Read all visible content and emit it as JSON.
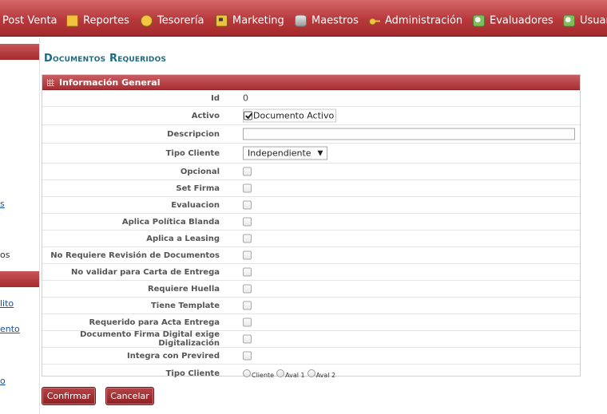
{
  "menu": {
    "items": [
      {
        "label": "Post Venta",
        "icon": ""
      },
      {
        "label": "Reportes",
        "icon": "book-icon"
      },
      {
        "label": "Tesorería",
        "icon": "coin-icon"
      },
      {
        "label": "Marketing",
        "icon": "monitor-icon"
      },
      {
        "label": "Maestros",
        "icon": "database-icon"
      },
      {
        "label": "Administración",
        "icon": "key-icon"
      },
      {
        "label": "Evaluadores",
        "icon": "evaluator-icon"
      },
      {
        "label": "Usuar",
        "icon": "evaluator-icon"
      }
    ]
  },
  "sidebar": {
    "fragments": [
      "s",
      "os",
      "lito",
      "ento",
      "o"
    ]
  },
  "page": {
    "title": "Documentos Requeridos"
  },
  "panel": {
    "title": "Información General",
    "fields": {
      "id": {
        "label": "Id",
        "value": "0"
      },
      "activo": {
        "label": "Activo",
        "checkbox_label": "Documento Activo",
        "checked": true
      },
      "descripcion": {
        "label": "Descripcion",
        "value": ""
      },
      "tipo_cliente_select": {
        "label": "Tipo Cliente",
        "value": "Independiente"
      },
      "checkboxes": [
        {
          "label": "Opcional",
          "checked": false
        },
        {
          "label": "Set Firma",
          "checked": false
        },
        {
          "label": "Evaluacion",
          "checked": false
        },
        {
          "label": "Aplica Política Blanda",
          "checked": false
        },
        {
          "label": "Aplica a Leasing",
          "checked": false
        },
        {
          "label": "No Requiere Revisión de Documentos",
          "checked": false
        },
        {
          "label": "No validar para Carta de Entrega",
          "checked": false
        },
        {
          "label": "Requiere Huella",
          "checked": false
        },
        {
          "label": "Tiene Template",
          "checked": false
        },
        {
          "label": "Requerido para Acta Entrega",
          "checked": false
        },
        {
          "label": "Documento Firma Digital exige Digitalización",
          "checked": false
        },
        {
          "label": "Integra con Previred",
          "checked": false
        }
      ],
      "tipo_cliente_radio": {
        "label": "Tipo Cliente",
        "options": [
          "Cliente",
          "Aval 1",
          "Aval 2"
        ]
      }
    }
  },
  "actions": {
    "confirm_label": "Confirmar",
    "cancel_label": "Cancelar"
  },
  "colors": {
    "menu_bar": "#b8393c",
    "title": "#1b6b80",
    "button": "#a52a2d"
  }
}
